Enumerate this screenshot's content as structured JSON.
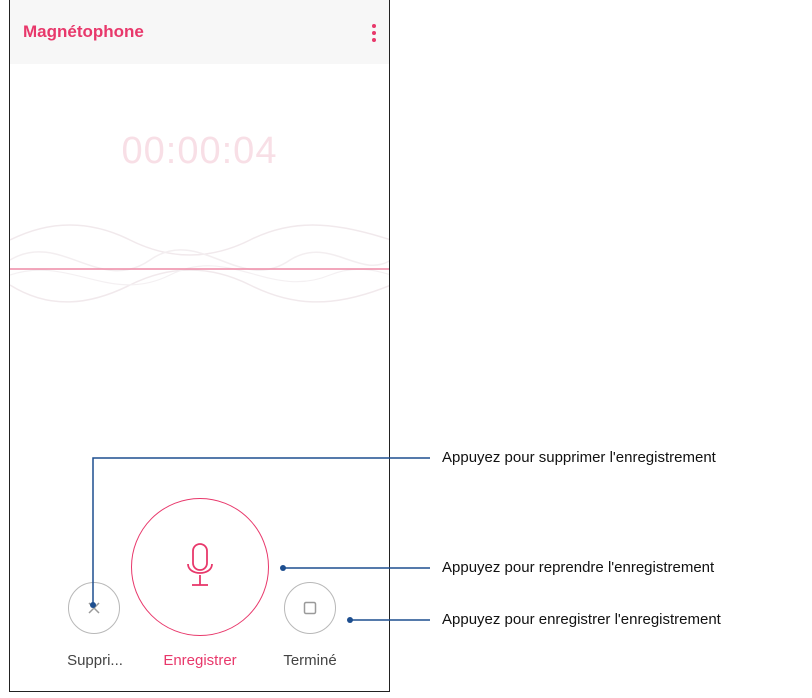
{
  "app": {
    "title": "Magnétophone",
    "accent_color": "#e8386b",
    "menu_icon": "more-vert-icon"
  },
  "recorder": {
    "elapsed_time": "00:00:04",
    "waveform": "wave-icon"
  },
  "controls": {
    "delete": {
      "label": "Suppri...",
      "icon": "close-icon"
    },
    "record": {
      "label": "Enregistrer",
      "icon": "microphone-icon"
    },
    "done": {
      "label": "Terminé",
      "icon": "stop-icon"
    }
  },
  "callouts": [
    "Appuyez pour supprimer l'enregistrement",
    "Appuyez pour reprendre l'enregistrement",
    "Appuyez pour enregistrer l'enregistrement"
  ]
}
